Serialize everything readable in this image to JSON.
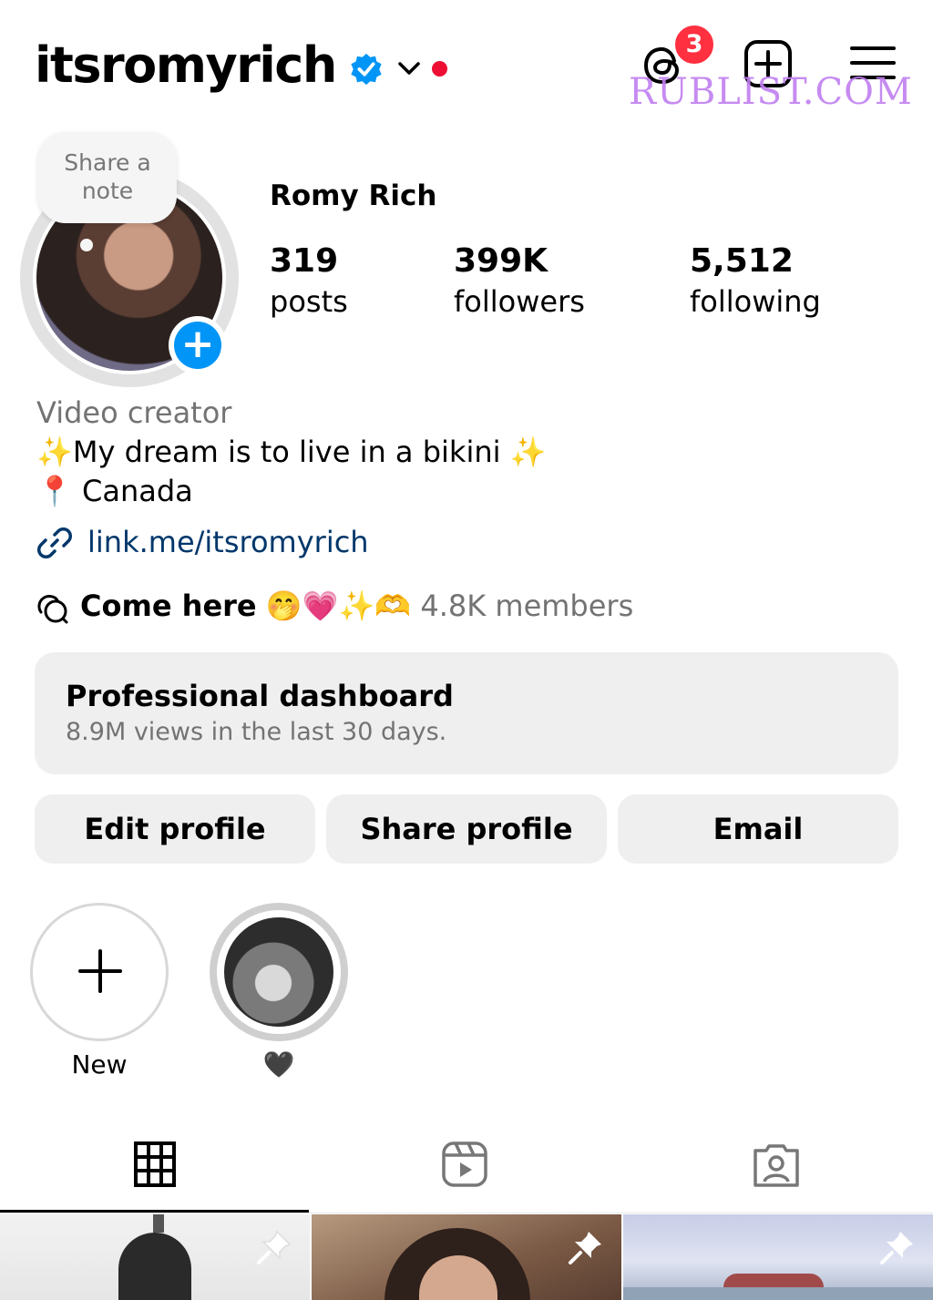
{
  "header": {
    "username": "itsromyrich",
    "notification_count": "3",
    "watermark": "RUBLIST.COM"
  },
  "profile": {
    "note_prompt": "Share a\nnote",
    "full_name": "Romy Rich",
    "stats": {
      "posts_count": "319",
      "posts_label": "posts",
      "followers_count": "399K",
      "followers_label": "followers",
      "following_count": "5,512",
      "following_label": "following"
    },
    "bio": {
      "category": "Video creator",
      "line1": "✨My dream is to live in a bikini ✨",
      "line2": "📍 Canada",
      "link": "link.me/itsromyrich"
    },
    "channel": {
      "name": "Come here",
      "emojis": "🤭💗✨🫶",
      "members": "4.8K members"
    }
  },
  "dashboard": {
    "title": "Professional dashboard",
    "subtitle": "8.9M views in the last 30 days."
  },
  "actions": {
    "edit": "Edit profile",
    "share": "Share profile",
    "email": "Email"
  },
  "highlights": [
    {
      "label": "New"
    },
    {
      "label": "🖤"
    }
  ],
  "tabs": [
    "grid-icon",
    "reels-icon",
    "tagged-icon"
  ],
  "colors": {
    "accent": "#0095f6",
    "badge": "#ff3040",
    "link": "#00376b",
    "secondary_text": "#737373",
    "button_bg": "#efefef"
  }
}
